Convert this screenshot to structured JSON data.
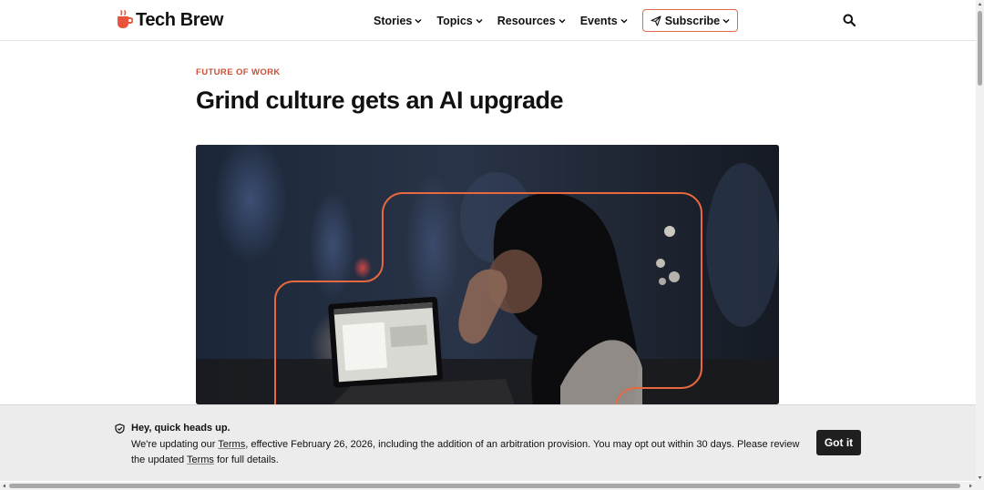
{
  "header": {
    "brand": "Tech Brew",
    "nav": [
      {
        "label": "Stories"
      },
      {
        "label": "Topics"
      },
      {
        "label": "Resources"
      },
      {
        "label": "Events"
      }
    ],
    "subscribe_label": "Subscribe",
    "search_icon": "search-icon",
    "accent_color": "#e06a4a"
  },
  "article": {
    "category": "FUTURE OF WORK",
    "headline": "Grind culture gets an AI upgrade",
    "hero_image": "woman-at-laptop-night-city"
  },
  "banner": {
    "title": "Hey, quick heads up.",
    "text_1": "We're updating our ",
    "terms_link_1": "Terms",
    "text_2": ", effective February 26, 2026, including the addition of an arbitration provision. You may opt out within 30 days. Please review the updated ",
    "terms_link_2": "Terms",
    "text_3": " for full details.",
    "button_label": "Got it"
  }
}
